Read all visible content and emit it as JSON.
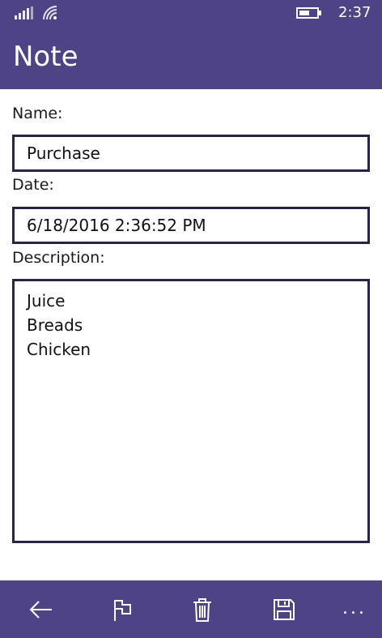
{
  "status_bar": {
    "time": "2:37",
    "icons": [
      "signal-icon",
      "wifi-icon",
      "battery-icon"
    ]
  },
  "header": {
    "title": "Note"
  },
  "form": {
    "name_label": "Name:",
    "name_value": "Purchase",
    "date_label": "Date:",
    "date_value": "6/18/2016 2:36:52 PM",
    "description_label": "Description:",
    "description_lines": [
      "Juice",
      "Breads",
      "Chicken"
    ]
  },
  "app_bar": {
    "buttons": [
      "back-icon",
      "flag-icon",
      "delete-icon",
      "save-icon"
    ],
    "more_label": "..."
  },
  "colors": {
    "accent": "#4e4385",
    "border": "#2b2248",
    "text": "#111111",
    "on_accent": "#ffffff"
  }
}
